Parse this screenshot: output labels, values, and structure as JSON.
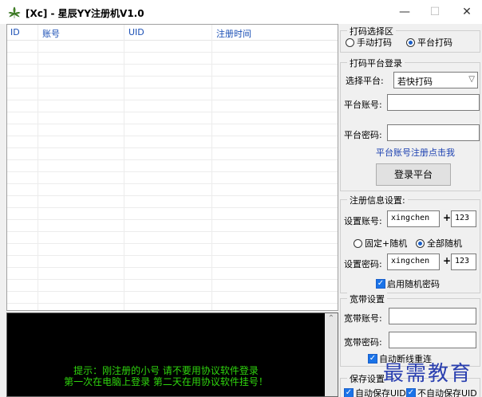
{
  "window": {
    "title": "[Xc] - 星辰YY注册机V1.0",
    "min_glyph": "—",
    "max_glyph": "☐",
    "close_glyph": "✕",
    "icon": "cannabis-leaf-icon"
  },
  "list": {
    "columns": [
      "ID",
      "账号",
      "UID",
      "注册时间"
    ]
  },
  "log": {
    "line1": "提示：刚注册的小号 请不要用协议软件登录",
    "line2": "第一次在电脑上登录 第二天在用协议软件挂号！",
    "scroll_up": "⌃"
  },
  "captcha_mode": {
    "title": "打码选择区",
    "manual": "手动打码",
    "platform": "平台打码",
    "selected": "platform"
  },
  "platform_login": {
    "title": "打码平台登录",
    "select_label": "选择平台:",
    "select_value": "若快打码",
    "account_label": "平台账号:",
    "account_value": "",
    "password_label": "平台密码:",
    "password_value": "",
    "register_link": "平台账号注册点击我",
    "login_button": "登录平台"
  },
  "register_settings": {
    "title": "注册信息设置:",
    "account_label": "设置账号:",
    "account_prefix": "xingchen",
    "plus": "+",
    "account_suffix": "123",
    "fixed_random": "固定+随机",
    "all_random": "全部随机",
    "selected": "all_random",
    "password_label": "设置密码:",
    "password_prefix": "xingchen",
    "password_suffix": "123",
    "random_password": "启用随机密码",
    "random_password_checked": true
  },
  "broadband": {
    "title": "宽带设置",
    "account_label": "宽带账号:",
    "account_value": "",
    "password_label": "宽带密码:",
    "password_value": "",
    "auto_reconnect": "自动断线重连",
    "auto_reconnect_checked": true
  },
  "save": {
    "title": "保存设置",
    "auto_save": "自动保存UID",
    "no_auto_save": "不自动保存UID",
    "auto_save_checked": true,
    "no_auto_save_checked": true
  },
  "watermark": "最需教育",
  "colors": {
    "log_text": "#2fd40e",
    "link": "#1a3fb0",
    "header_text": "#1a4fb5",
    "accent": "#1a73e8"
  }
}
